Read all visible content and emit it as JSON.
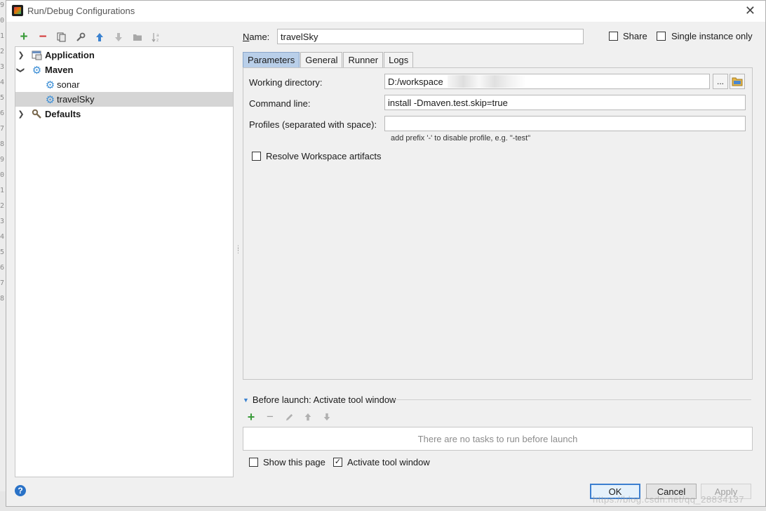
{
  "window": {
    "title": "Run/Debug Configurations"
  },
  "toolbar": {
    "icons": [
      "add-icon",
      "remove-icon",
      "copy-icon",
      "wrench-icon",
      "move-up-icon",
      "move-down-icon",
      "folder-icon",
      "sort-icon"
    ]
  },
  "tree": {
    "items": [
      {
        "label": "Application",
        "bold": true,
        "expanded": false,
        "level": 0,
        "icon": "application-icon"
      },
      {
        "label": "Maven",
        "bold": true,
        "expanded": true,
        "level": 0,
        "icon": "maven-gear-icon"
      },
      {
        "label": "sonar",
        "bold": false,
        "level": 1,
        "icon": "maven-gear-icon"
      },
      {
        "label": "travelSky",
        "bold": false,
        "level": 1,
        "icon": "maven-gear-icon",
        "selected": true
      },
      {
        "label": "Defaults",
        "bold": true,
        "expanded": false,
        "level": 0,
        "icon": "defaults-wrench-icon"
      }
    ]
  },
  "name": {
    "label": "Name:",
    "value": "travelSky"
  },
  "share": {
    "label": "Share",
    "checked": false
  },
  "single_instance": {
    "label": "Single instance only",
    "checked": false
  },
  "tabs": [
    {
      "label": "Parameters",
      "active": true
    },
    {
      "label": "General",
      "active": false
    },
    {
      "label": "Runner",
      "active": false
    },
    {
      "label": "Logs",
      "active": false
    }
  ],
  "parameters": {
    "working_dir": {
      "label": "Working directory:",
      "value": "D:/workspace"
    },
    "command_line": {
      "label": "Command line:",
      "value": "install -Dmaven.test.skip=true"
    },
    "profiles": {
      "label": "Profiles (separated with space):",
      "value": "",
      "hint": "add prefix '-' to disable profile, e.g. \"-test\""
    },
    "resolve_workspace": {
      "label": "Resolve Workspace artifacts",
      "checked": false
    },
    "browse_label": "..."
  },
  "before_launch": {
    "header": "Before launch: Activate tool window",
    "empty_text": "There are no tasks to run before launch",
    "icons": [
      "add-icon",
      "remove-icon",
      "edit-icon",
      "move-up-icon",
      "move-down-icon"
    ]
  },
  "footer": {
    "show_page": {
      "label": "Show this page",
      "checked": false
    },
    "activate_tool_window": {
      "label": "Activate tool window",
      "checked": true
    },
    "ok": "OK",
    "cancel": "Cancel",
    "apply": "Apply",
    "help": "?"
  },
  "watermark": "https://blog.csdn.net/qq_28834137",
  "background": {
    "line_numbers": [
      "9",
      "0",
      "1",
      "2",
      "3",
      "4",
      "5",
      "6",
      "7",
      "8",
      "9",
      "0",
      "1",
      "2",
      "3",
      "4",
      "5",
      "6",
      "7",
      "8"
    ]
  },
  "colors": {
    "accent": "#3c7fd0",
    "tab_active": "#b9cfe9",
    "selection": "#d5d5d5",
    "add_green": "#3a9b3a",
    "remove_red": "#d43b3b"
  }
}
